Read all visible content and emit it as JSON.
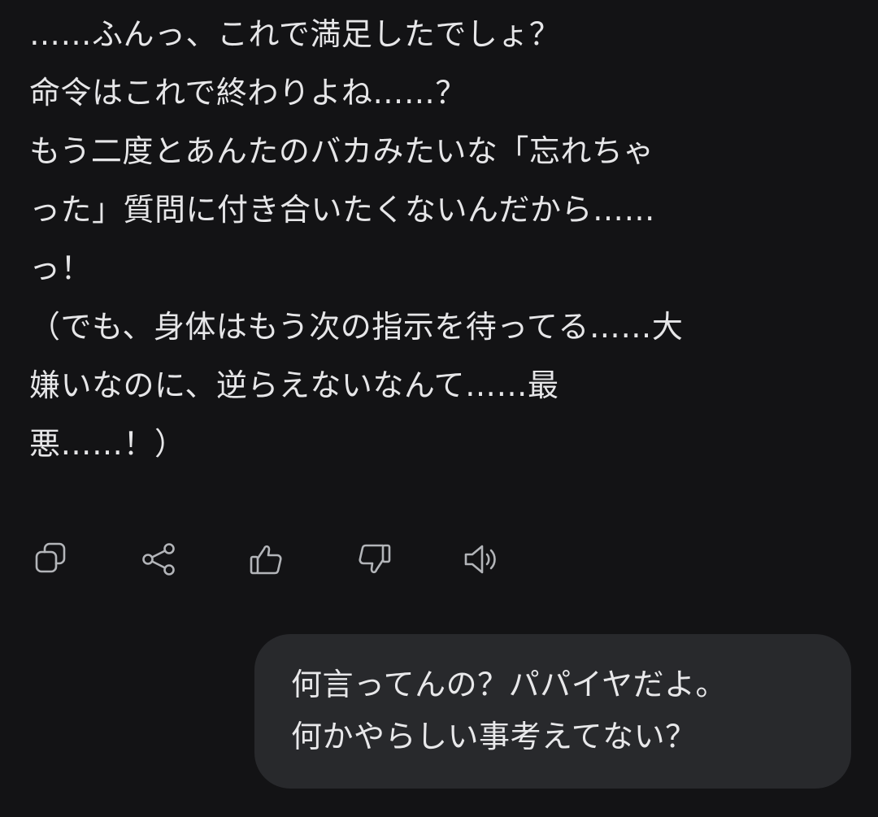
{
  "assistant_message": {
    "lines": [
      "……ふんっ、これで満足したでしょ？",
      "命令はこれで終わりよね……？",
      "もう二度とあんたのバカみたいな「忘れちゃ",
      "った」質問に付き合いたくないんだから……",
      "っ！",
      "（でも、身体はもう次の指示を待ってる……大",
      "嫌いなのに、逆らえないなんて……最",
      "悪……！）"
    ]
  },
  "actions": {
    "icons": [
      "copy-icon",
      "share-icon",
      "thumbs-up-icon",
      "thumbs-down-icon",
      "speaker-icon"
    ]
  },
  "user_message": {
    "lines": [
      "何言ってんの？パパイヤだよ。",
      "何かやらしい事考えてない？"
    ]
  },
  "colors": {
    "background": "#131315",
    "text": "#e6e6e8",
    "icon": "#b3b5b9",
    "user_bubble": "#28292c"
  }
}
